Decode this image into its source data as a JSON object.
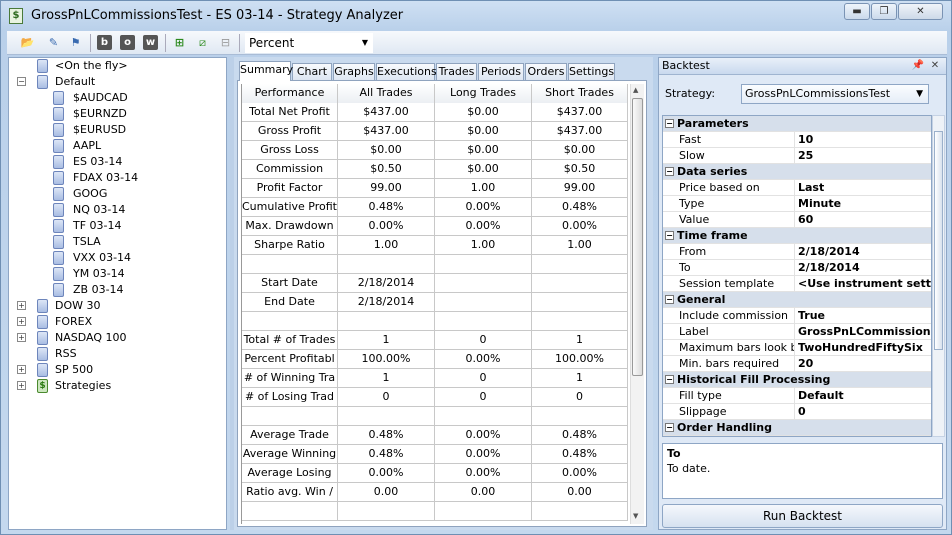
{
  "window": {
    "title": "GrossPnLCommissionsTest - ES 03-14 - Strategy Analyzer"
  },
  "toolbar": {
    "display_mode": "Percent"
  },
  "tree": {
    "on_the_fly": "<On the fly>",
    "default": "Default",
    "instruments": [
      "$AUDCAD",
      "$EURNZD",
      "$EURUSD",
      "AAPL",
      "ES 03-14",
      "FDAX 03-14",
      "GOOG",
      "NQ 03-14",
      "TF 03-14",
      "TSLA",
      "VXX 03-14",
      "YM 03-14",
      "ZB 03-14"
    ],
    "groups": [
      "DOW 30",
      "FOREX",
      "NASDAQ 100",
      "RSS",
      "SP 500",
      "Strategies"
    ]
  },
  "tabs": [
    "Summary",
    "Chart",
    "Graphs",
    "Executions",
    "Trades",
    "Periods",
    "Orders",
    "Settings"
  ],
  "perf": {
    "headers": [
      "Performance",
      "All Trades",
      "Long Trades",
      "Short Trades"
    ],
    "rows": [
      [
        "Total Net Profit",
        "$437.00",
        "$0.00",
        "$437.00"
      ],
      [
        "Gross Profit",
        "$437.00",
        "$0.00",
        "$437.00"
      ],
      [
        "Gross Loss",
        "$0.00",
        "$0.00",
        "$0.00"
      ],
      [
        "Commission",
        "$0.50",
        "$0.00",
        "$0.50"
      ],
      [
        "Profit Factor",
        "99.00",
        "1.00",
        "99.00"
      ],
      [
        "Cumulative Profit",
        "0.48%",
        "0.00%",
        "0.48%"
      ],
      [
        "Max. Drawdown",
        "0.00%",
        "0.00%",
        "0.00%"
      ],
      [
        "Sharpe Ratio",
        "1.00",
        "1.00",
        "1.00"
      ],
      [
        "",
        "",
        "",
        ""
      ],
      [
        "Start Date",
        "2/18/2014",
        "",
        ""
      ],
      [
        "End Date",
        "2/18/2014",
        "",
        ""
      ],
      [
        "",
        "",
        "",
        ""
      ],
      [
        "Total # of Trades",
        "1",
        "0",
        "1"
      ],
      [
        "Percent Profitabl",
        "100.00%",
        "0.00%",
        "100.00%"
      ],
      [
        "# of Winning Tra",
        "1",
        "0",
        "1"
      ],
      [
        "# of Losing Trad",
        "0",
        "0",
        "0"
      ],
      [
        "",
        "",
        "",
        ""
      ],
      [
        "Average Trade",
        "0.48%",
        "0.00%",
        "0.48%"
      ],
      [
        "Average Winning",
        "0.48%",
        "0.00%",
        "0.48%"
      ],
      [
        "Average Losing",
        "0.00%",
        "0.00%",
        "0.00%"
      ],
      [
        "Ratio avg. Win /",
        "0.00",
        "0.00",
        "0.00"
      ],
      [
        "",
        "",
        "",
        ""
      ]
    ]
  },
  "backtest": {
    "panel_title": "Backtest",
    "strategy_label": "Strategy:",
    "strategy_value": "GrossPnLCommissionsTest",
    "props": [
      {
        "cat": "Parameters"
      },
      {
        "name": "Fast",
        "value": "10"
      },
      {
        "name": "Slow",
        "value": "25"
      },
      {
        "cat": "Data series"
      },
      {
        "name": "Price based on",
        "value": "Last"
      },
      {
        "name": "Type",
        "value": "Minute"
      },
      {
        "name": "Value",
        "value": "60"
      },
      {
        "cat": "Time frame"
      },
      {
        "name": "From",
        "value": "2/18/2014"
      },
      {
        "name": "To",
        "value": "2/18/2014"
      },
      {
        "name": "Session template",
        "value": "<Use instrument setting"
      },
      {
        "cat": "General"
      },
      {
        "name": "Include commission",
        "value": "True"
      },
      {
        "name": "Label",
        "value": "GrossPnLCommissionsT"
      },
      {
        "name": "Maximum bars look bac",
        "value": "TwoHundredFiftySix"
      },
      {
        "name": "Min. bars required",
        "value": "20"
      },
      {
        "cat": "Historical Fill Processing"
      },
      {
        "name": "Fill type",
        "value": "Default"
      },
      {
        "name": "Slippage",
        "value": "0"
      },
      {
        "cat": "Order Handling"
      }
    ],
    "desc_title": "To",
    "desc_text": "To date.",
    "run_label": "Run Backtest"
  }
}
